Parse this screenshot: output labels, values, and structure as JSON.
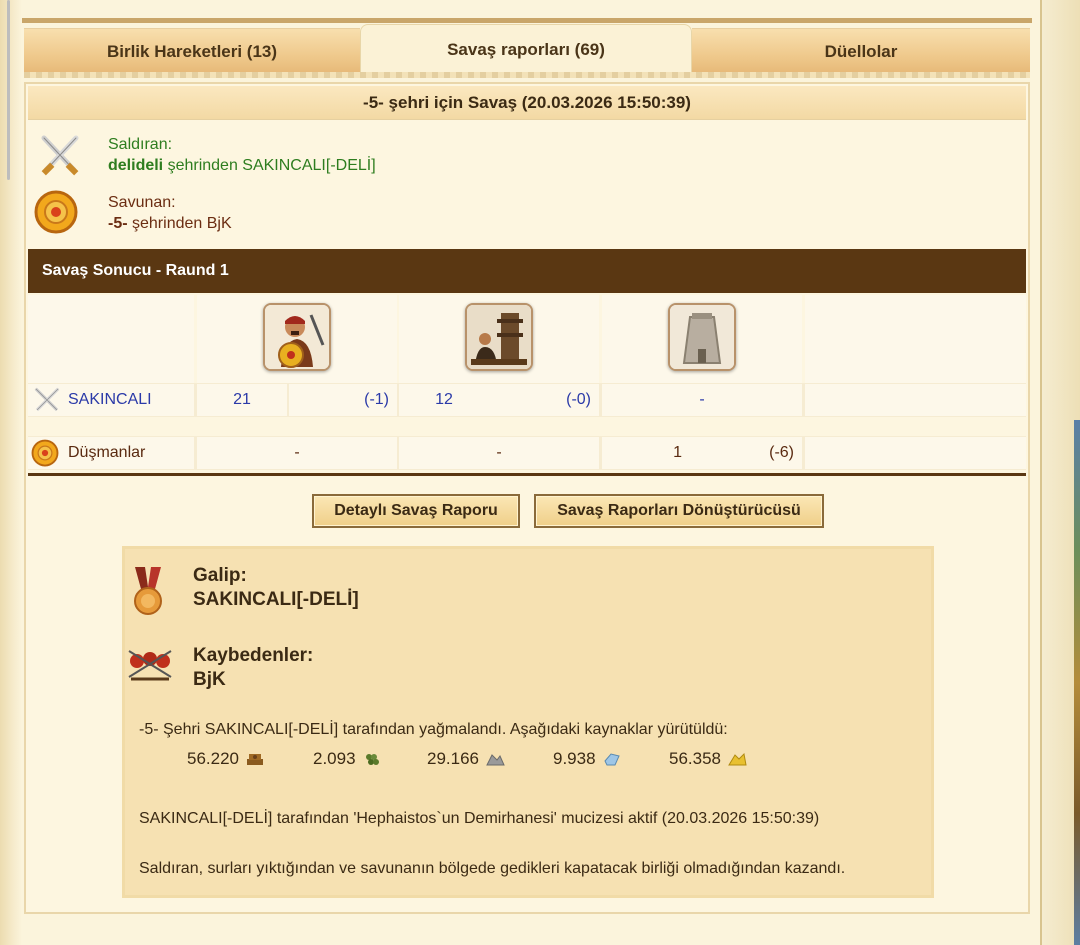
{
  "tabs": [
    {
      "label": "Birlik Hareketleri (13)"
    },
    {
      "label": "Savaş raporları (69)"
    },
    {
      "label": "Düellolar"
    }
  ],
  "report": {
    "title": "-5- şehri için Savaş (20.03.2026 15:50:39)",
    "attacker": {
      "label": "Saldıran:",
      "city": "delideli",
      "rest": " şehrinden SAKINCALI[-DELİ]",
      "icon": "crossed-swords-icon"
    },
    "defender": {
      "label": "Savunan:",
      "city": "-5-",
      "rest": " şehrinden BjK",
      "icon": "shield-icon"
    }
  },
  "battle": {
    "title": "Savaş Sonucu - Raund 1",
    "units": [
      {
        "name": "hoplite-unit-icon"
      },
      {
        "name": "siege-catapult-unit-icon"
      },
      {
        "name": "wall-tower-unit-icon"
      }
    ],
    "rows": [
      {
        "name": "SAKINCALI",
        "icon": "crossed-swords-icon",
        "cells": [
          {
            "count": "21",
            "loss": "(-1)"
          },
          {
            "count": "12",
            "loss": "(-0)"
          },
          {
            "count": "-",
            "loss": ""
          }
        ]
      },
      {
        "name": "Düşmanlar",
        "icon": "shield-icon",
        "cells": [
          {
            "count": "-",
            "loss": ""
          },
          {
            "count": "-",
            "loss": ""
          },
          {
            "count": "1",
            "loss": "(-6)"
          }
        ]
      }
    ]
  },
  "buttons": {
    "detailed": "Detaylı Savaş Raporu",
    "converter": "Savaş Raporları Dönüştürücüsü"
  },
  "summary": {
    "winner_label": "Galip:",
    "winner": "SAKINCALI[-DELİ]",
    "losers_label": "Kaybedenler:",
    "losers": "BjK",
    "plunder_text": "-5- Şehri SAKINCALI[-DELİ] tarafından yağmalandı. Aşağıdaki kaynaklar yürütüldü:",
    "resources": [
      {
        "value": "56.220",
        "icon": "wood-icon"
      },
      {
        "value": "2.093",
        "icon": "grapes-icon"
      },
      {
        "value": "29.166",
        "icon": "marble-icon"
      },
      {
        "value": "9.938",
        "icon": "crystal-icon"
      },
      {
        "value": "56.358",
        "icon": "sulfur-icon"
      }
    ],
    "wonder_text": "SAKINCALI[-DELİ] tarafından 'Hephaistos`un Demirhanesi' mucizesi aktif (20.03.2026 15:50:39)",
    "reason_text": "Saldıran, surları yıktığından ve savunanın bölgede gedikleri kapatacak birliği olmadığından kazandı."
  }
}
